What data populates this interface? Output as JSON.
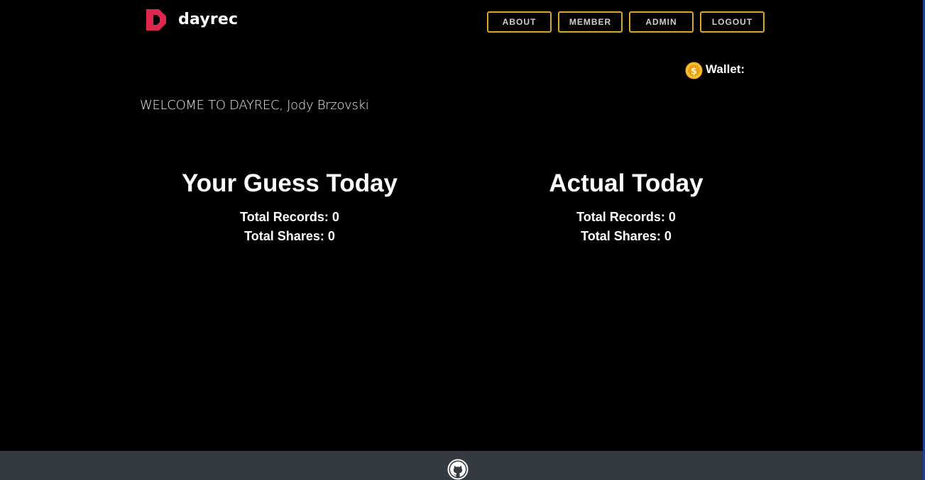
{
  "brand": {
    "name": "dayrec",
    "logo_icon": "dayrec-logo-icon",
    "logo_color": "#e0284f"
  },
  "nav": {
    "items": [
      {
        "label": "ABOUT"
      },
      {
        "label": "MEMBER"
      },
      {
        "label": "ADMIN"
      },
      {
        "label": "LOGOUT"
      }
    ],
    "border_color": "#e0a526"
  },
  "wallet": {
    "label": "Wallet:",
    "icon": "coin-icon",
    "icon_color": "#f5b21c"
  },
  "welcome": {
    "text": "WELCOME TO DAYREC, Jody Brzovski"
  },
  "guess_panel": {
    "title": "Your Guess Today",
    "total_records": "Total Records: 0",
    "total_shares": "Total Shares: 0"
  },
  "actual_panel": {
    "title": "Actual Today",
    "total_records": "Total Records: 0",
    "total_shares": "Total Shares: 0"
  },
  "footer": {
    "icon": "github-icon",
    "background": "#343a40"
  }
}
